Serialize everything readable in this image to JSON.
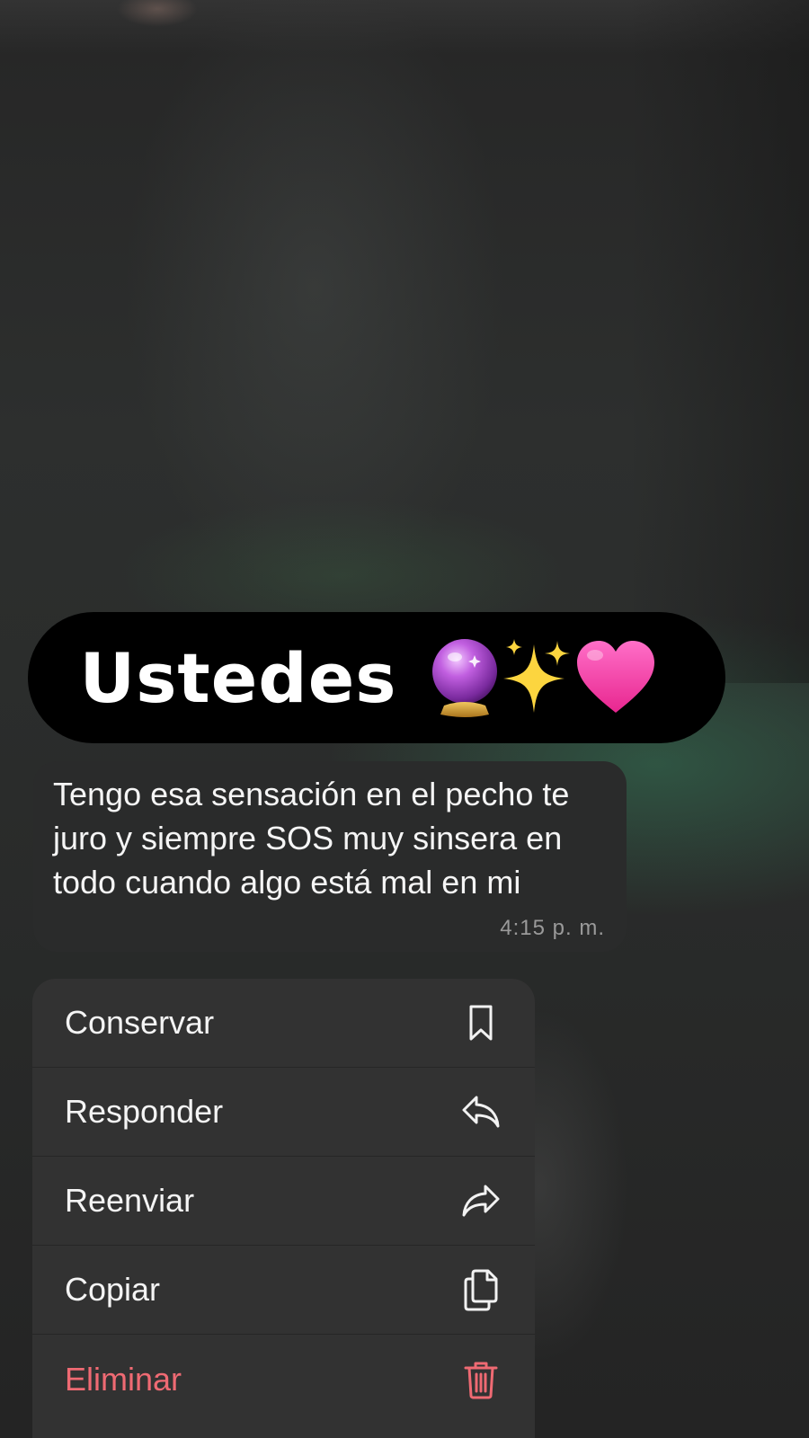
{
  "banner": {
    "text": "Ustedes",
    "emojis": [
      "crystal-ball-icon",
      "sparkles-icon",
      "pink-heart-icon"
    ]
  },
  "message": {
    "text": "Tengo esa sensación en el pecho te juro y siempre SOS muy sinsera en todo cuando algo está mal en mi",
    "time": "4:15 p. m."
  },
  "menu": {
    "items": [
      {
        "label": "Conservar",
        "icon": "bookmark-icon"
      },
      {
        "label": "Responder",
        "icon": "reply-icon"
      },
      {
        "label": "Reenviar",
        "icon": "forward-icon"
      },
      {
        "label": "Copiar",
        "icon": "copy-icon"
      },
      {
        "label": "Eliminar",
        "icon": "trash-icon"
      }
    ]
  },
  "colors": {
    "banner_bg": "#000000",
    "bubble_bg": "#2a2b2b",
    "menu_bg": "#323232",
    "danger": "#ef6a73",
    "timestamp": "#9a9a9a"
  }
}
